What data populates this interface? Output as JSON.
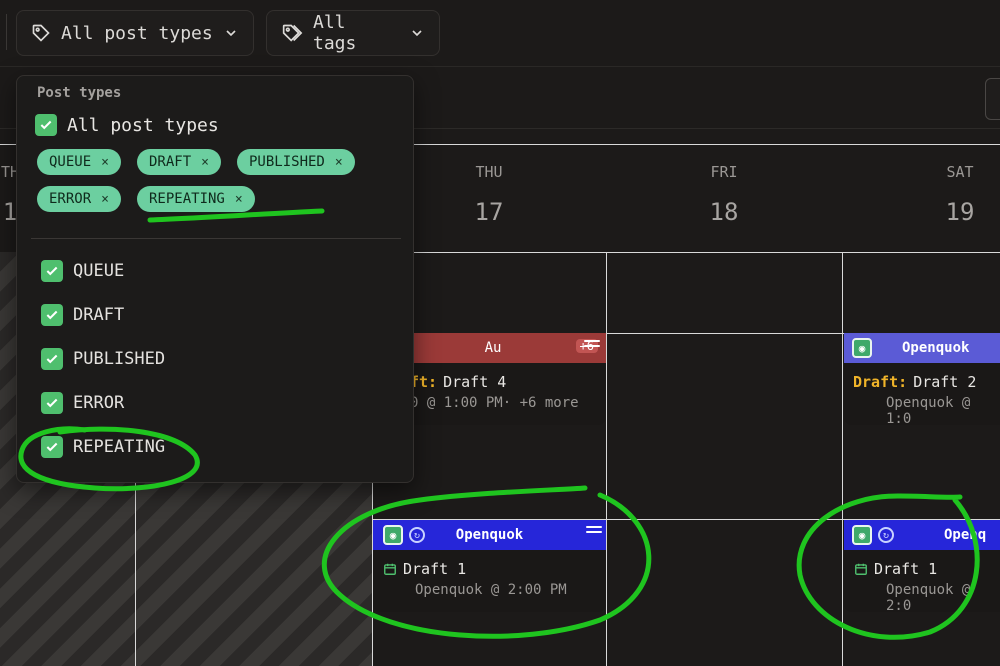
{
  "filters": {
    "post_types_label": "All post types",
    "tags_label": "All tags"
  },
  "calendar": {
    "days": [
      {
        "name": "TH",
        "num": "1"
      },
      {
        "name": "THU",
        "num": "17"
      },
      {
        "name": "FRI",
        "num": "18"
      },
      {
        "name": "SAT",
        "num": "19"
      }
    ]
  },
  "events": {
    "thu_top": {
      "head": "Au",
      "more_badge": "+6",
      "draft_prefix": "ft:",
      "title": "Draft 4",
      "sub": "0 @ 1:00 PM· +6 more",
      "color": "#9b3a38"
    },
    "sat_top": {
      "head": "Openquok",
      "draft_prefix": "Draft:",
      "title": "Draft 2",
      "sub": "Openquok @ 1:0",
      "color": "#5b5bd6"
    },
    "thu_bottom": {
      "head": "Openquok",
      "title": "Draft 1",
      "sub": "Openquok @ 2:00 PM",
      "color": "#2626d9"
    },
    "sat_bottom": {
      "head": "Openq",
      "title": "Draft 1",
      "sub": "Openquok @ 2:0",
      "color": "#2626d9"
    }
  },
  "dropdown": {
    "heading": "Post types",
    "all_label": "All post types",
    "chips": [
      {
        "label": "QUEUE",
        "remove": "×"
      },
      {
        "label": "DRAFT",
        "remove": "×"
      },
      {
        "label": "PUBLISHED",
        "remove": "×"
      },
      {
        "label": "ERROR",
        "remove": "×"
      },
      {
        "label": "REPEATING",
        "remove": "×"
      }
    ],
    "options": [
      {
        "label": "QUEUE",
        "checked": true
      },
      {
        "label": "DRAFT",
        "checked": true
      },
      {
        "label": "PUBLISHED",
        "checked": true
      },
      {
        "label": "ERROR",
        "checked": true
      },
      {
        "label": "REPEATING",
        "checked": true
      }
    ]
  },
  "colors": {
    "accent_green": "#4fbf6e",
    "chip_green": "#6ccfa0",
    "annotation_green": "#1fc41f"
  }
}
